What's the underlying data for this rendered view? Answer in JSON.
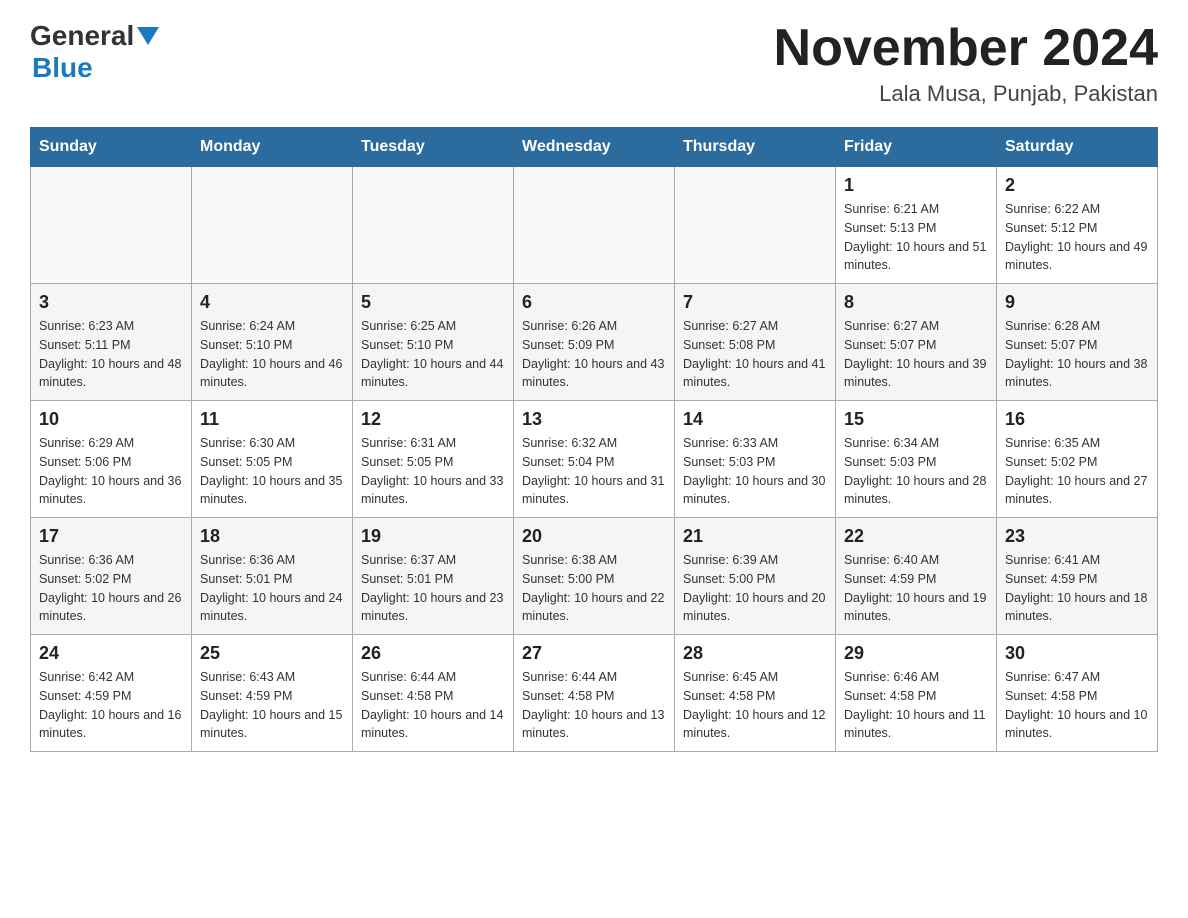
{
  "header": {
    "logo": {
      "general": "General",
      "blue_arrow": "▲",
      "blue": "Blue"
    },
    "title": "November 2024",
    "location": "Lala Musa, Punjab, Pakistan"
  },
  "days_of_week": [
    "Sunday",
    "Monday",
    "Tuesday",
    "Wednesday",
    "Thursday",
    "Friday",
    "Saturday"
  ],
  "weeks": [
    [
      {
        "day": "",
        "info": ""
      },
      {
        "day": "",
        "info": ""
      },
      {
        "day": "",
        "info": ""
      },
      {
        "day": "",
        "info": ""
      },
      {
        "day": "",
        "info": ""
      },
      {
        "day": "1",
        "info": "Sunrise: 6:21 AM\nSunset: 5:13 PM\nDaylight: 10 hours and 51 minutes."
      },
      {
        "day": "2",
        "info": "Sunrise: 6:22 AM\nSunset: 5:12 PM\nDaylight: 10 hours and 49 minutes."
      }
    ],
    [
      {
        "day": "3",
        "info": "Sunrise: 6:23 AM\nSunset: 5:11 PM\nDaylight: 10 hours and 48 minutes."
      },
      {
        "day": "4",
        "info": "Sunrise: 6:24 AM\nSunset: 5:10 PM\nDaylight: 10 hours and 46 minutes."
      },
      {
        "day": "5",
        "info": "Sunrise: 6:25 AM\nSunset: 5:10 PM\nDaylight: 10 hours and 44 minutes."
      },
      {
        "day": "6",
        "info": "Sunrise: 6:26 AM\nSunset: 5:09 PM\nDaylight: 10 hours and 43 minutes."
      },
      {
        "day": "7",
        "info": "Sunrise: 6:27 AM\nSunset: 5:08 PM\nDaylight: 10 hours and 41 minutes."
      },
      {
        "day": "8",
        "info": "Sunrise: 6:27 AM\nSunset: 5:07 PM\nDaylight: 10 hours and 39 minutes."
      },
      {
        "day": "9",
        "info": "Sunrise: 6:28 AM\nSunset: 5:07 PM\nDaylight: 10 hours and 38 minutes."
      }
    ],
    [
      {
        "day": "10",
        "info": "Sunrise: 6:29 AM\nSunset: 5:06 PM\nDaylight: 10 hours and 36 minutes."
      },
      {
        "day": "11",
        "info": "Sunrise: 6:30 AM\nSunset: 5:05 PM\nDaylight: 10 hours and 35 minutes."
      },
      {
        "day": "12",
        "info": "Sunrise: 6:31 AM\nSunset: 5:05 PM\nDaylight: 10 hours and 33 minutes."
      },
      {
        "day": "13",
        "info": "Sunrise: 6:32 AM\nSunset: 5:04 PM\nDaylight: 10 hours and 31 minutes."
      },
      {
        "day": "14",
        "info": "Sunrise: 6:33 AM\nSunset: 5:03 PM\nDaylight: 10 hours and 30 minutes."
      },
      {
        "day": "15",
        "info": "Sunrise: 6:34 AM\nSunset: 5:03 PM\nDaylight: 10 hours and 28 minutes."
      },
      {
        "day": "16",
        "info": "Sunrise: 6:35 AM\nSunset: 5:02 PM\nDaylight: 10 hours and 27 minutes."
      }
    ],
    [
      {
        "day": "17",
        "info": "Sunrise: 6:36 AM\nSunset: 5:02 PM\nDaylight: 10 hours and 26 minutes."
      },
      {
        "day": "18",
        "info": "Sunrise: 6:36 AM\nSunset: 5:01 PM\nDaylight: 10 hours and 24 minutes."
      },
      {
        "day": "19",
        "info": "Sunrise: 6:37 AM\nSunset: 5:01 PM\nDaylight: 10 hours and 23 minutes."
      },
      {
        "day": "20",
        "info": "Sunrise: 6:38 AM\nSunset: 5:00 PM\nDaylight: 10 hours and 22 minutes."
      },
      {
        "day": "21",
        "info": "Sunrise: 6:39 AM\nSunset: 5:00 PM\nDaylight: 10 hours and 20 minutes."
      },
      {
        "day": "22",
        "info": "Sunrise: 6:40 AM\nSunset: 4:59 PM\nDaylight: 10 hours and 19 minutes."
      },
      {
        "day": "23",
        "info": "Sunrise: 6:41 AM\nSunset: 4:59 PM\nDaylight: 10 hours and 18 minutes."
      }
    ],
    [
      {
        "day": "24",
        "info": "Sunrise: 6:42 AM\nSunset: 4:59 PM\nDaylight: 10 hours and 16 minutes."
      },
      {
        "day": "25",
        "info": "Sunrise: 6:43 AM\nSunset: 4:59 PM\nDaylight: 10 hours and 15 minutes."
      },
      {
        "day": "26",
        "info": "Sunrise: 6:44 AM\nSunset: 4:58 PM\nDaylight: 10 hours and 14 minutes."
      },
      {
        "day": "27",
        "info": "Sunrise: 6:44 AM\nSunset: 4:58 PM\nDaylight: 10 hours and 13 minutes."
      },
      {
        "day": "28",
        "info": "Sunrise: 6:45 AM\nSunset: 4:58 PM\nDaylight: 10 hours and 12 minutes."
      },
      {
        "day": "29",
        "info": "Sunrise: 6:46 AM\nSunset: 4:58 PM\nDaylight: 10 hours and 11 minutes."
      },
      {
        "day": "30",
        "info": "Sunrise: 6:47 AM\nSunset: 4:58 PM\nDaylight: 10 hours and 10 minutes."
      }
    ]
  ]
}
